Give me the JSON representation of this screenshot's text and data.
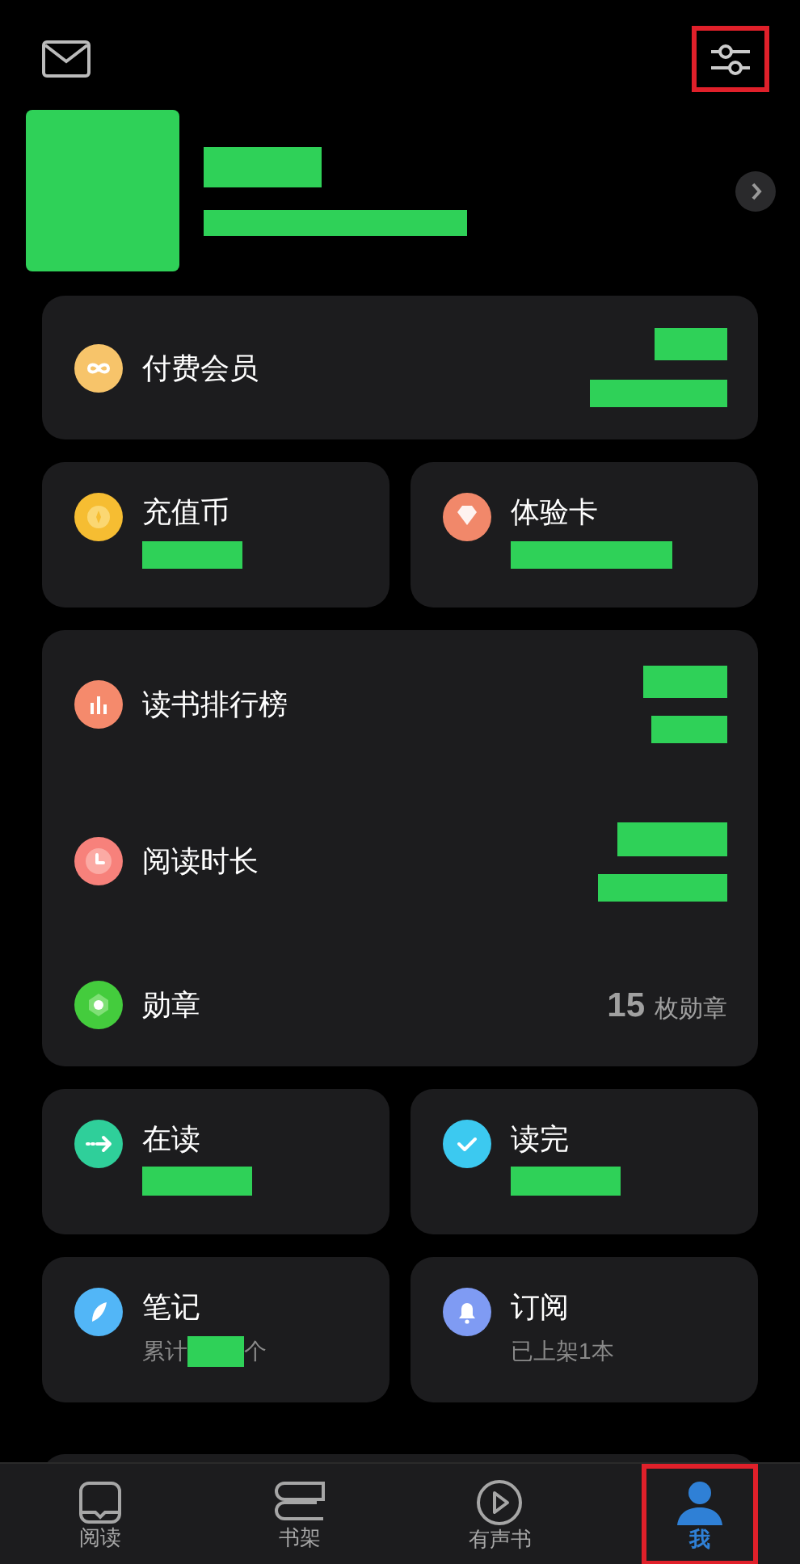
{
  "header": {
    "settings_annotated": true
  },
  "membership": {
    "label": "付费会员"
  },
  "wallet": [
    {
      "label": "充值币"
    },
    {
      "label": "体验卡"
    }
  ],
  "stats": [
    {
      "label": "读书排行榜"
    },
    {
      "label": "阅读时长"
    },
    {
      "label": "勋章",
      "count": "15",
      "unit": "枚勋章"
    }
  ],
  "library": [
    {
      "label": "在读"
    },
    {
      "label": "读完"
    },
    {
      "label": "笔记",
      "prefix": "累计",
      "suffix": "个"
    },
    {
      "label": "订阅",
      "detail": "已上架1本"
    }
  ],
  "tabs": [
    {
      "label": "阅读",
      "selected": false,
      "annotated": false
    },
    {
      "label": "书架",
      "selected": false,
      "annotated": false
    },
    {
      "label": "有声书",
      "selected": false,
      "annotated": false
    },
    {
      "label": "我",
      "selected": true,
      "annotated": true
    }
  ]
}
